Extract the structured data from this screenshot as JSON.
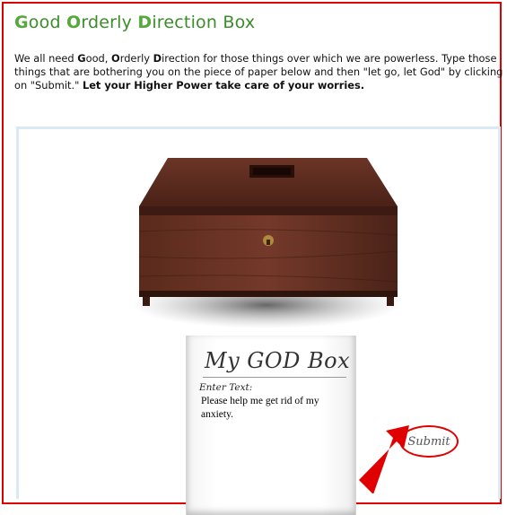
{
  "page": {
    "title_parts": [
      "G",
      "ood ",
      "O",
      "rderly ",
      "D",
      "irection Box"
    ],
    "intro": {
      "p1": "We all need ",
      "g": "G",
      "p2": "ood, ",
      "o": "O",
      "p3": "rderly ",
      "d": "D",
      "p4": "irection for those things over which we are powerless. Type those things that are bothering you on the piece of paper below and then \"let go, let God\" by clicking on \"Submit.\" ",
      "bold": "Let your Higher Power take care of your worries."
    }
  },
  "godbox": {
    "image": "wooden-box-icon",
    "paper": {
      "title": "My GOD Box",
      "enter_label": "Enter Text:",
      "text_value": "Please help me get rid of my anxiety."
    },
    "submit_label": "Submit",
    "annotation": "red-arrow-icon"
  },
  "colors": {
    "title_green": "#3c8c2c",
    "highlight_red": "#e00000",
    "panel_border": "#dbe9f4",
    "wood": "#5a2a1c"
  }
}
